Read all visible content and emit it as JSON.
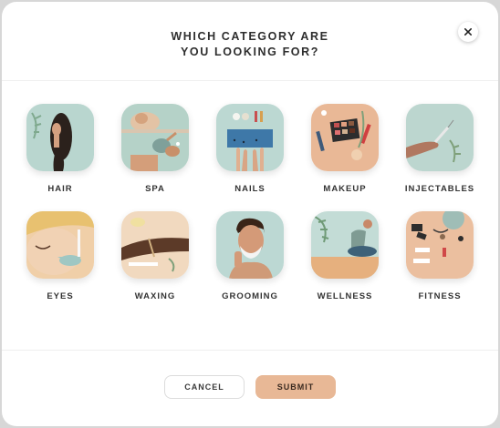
{
  "modal": {
    "title_line1": "WHICH CATEGORY ARE",
    "title_line2": "YOU LOOKING FOR?",
    "close_icon": "close-icon"
  },
  "categories": [
    {
      "label": "HAIR",
      "icon": "hair-illustration",
      "bg": "#b9d6cf"
    },
    {
      "label": "SPA",
      "icon": "spa-illustration",
      "bg": "#b5d2c8"
    },
    {
      "label": "NAILS",
      "icon": "nails-illustration",
      "bg": "#bcd8d2"
    },
    {
      "label": "MAKEUP",
      "icon": "makeup-illustration",
      "bg": "#e9b896"
    },
    {
      "label": "INJECTABLES",
      "icon": "injectables-illustration",
      "bg": "#bcd6cf"
    },
    {
      "label": "EYES",
      "icon": "eyes-illustration",
      "bg": "#f0cfa8"
    },
    {
      "label": "WAXING",
      "icon": "waxing-illustration",
      "bg": "#f1d9bf"
    },
    {
      "label": "GROOMING",
      "icon": "grooming-illustration",
      "bg": "#bcd8d3"
    },
    {
      "label": "WELLNESS",
      "icon": "wellness-illustration",
      "bg": "#c3dcd6"
    },
    {
      "label": "FITNESS",
      "icon": "fitness-illustration",
      "bg": "#ebbf9f"
    }
  ],
  "actions": {
    "cancel_label": "CANCEL",
    "submit_label": "SUBMIT"
  },
  "colors": {
    "accent": "#e8b896",
    "teal_tile": "#b9d6cf",
    "peach_tile": "#e9b896"
  }
}
